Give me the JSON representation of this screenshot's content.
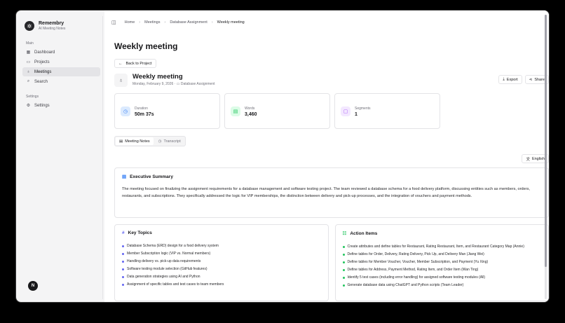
{
  "brand": {
    "title": "Remembry",
    "subtitle": "AI Meeting Notes",
    "logo_icon": "✲"
  },
  "sidebar": {
    "main_label": "Main",
    "items": [
      {
        "label": "Dashboard",
        "icon": "grid-icon",
        "glyph": "▦"
      },
      {
        "label": "Projects",
        "icon": "folder-icon",
        "glyph": "▭"
      },
      {
        "label": "Meetings",
        "icon": "mic-icon",
        "glyph": "♁"
      },
      {
        "label": "Search",
        "icon": "search-icon",
        "glyph": "⌕"
      }
    ],
    "settings_label": "Settings",
    "settings_item": {
      "label": "Settings",
      "icon": "gear-icon",
      "glyph": "⚙"
    },
    "avatar_initial": "N"
  },
  "breadcrumb": {
    "items": [
      "Home",
      "Meetings",
      "Database Assignment"
    ],
    "current": "Weekly meeting"
  },
  "page": {
    "title": "Weekly meeting",
    "back_label": "Back to Project",
    "meeting_title": "Weekly meeting",
    "meeting_date": "Monday, February 9, 2026",
    "meeting_project": "Database Assignment",
    "export_label": "Export",
    "share_label": "Share"
  },
  "stats": [
    {
      "label": "Duration",
      "value": "50m 37s",
      "icon": "clock-icon",
      "glyph": "◷",
      "color": "#3b82f6",
      "bg": "#dbeafe"
    },
    {
      "label": "Words",
      "value": "3,460",
      "icon": "file-text-icon",
      "glyph": "▤",
      "color": "#22c55e",
      "bg": "#dcfce7"
    },
    {
      "label": "Segments",
      "value": "1",
      "icon": "message-icon",
      "glyph": "▢",
      "color": "#a855f7",
      "bg": "#f3e8ff"
    }
  ],
  "tabs": {
    "notes": "Meeting Notes",
    "transcript": "Transcript"
  },
  "language": "English",
  "summary": {
    "title": "Executive Summary",
    "text": "The meeting focused on finalizing the assignment requirements for a database management and software testing project. The team reviewed a database schema for a food delivery platform, discussing entities such as members, orders, restaurants, and subscriptions. They specifically addressed the logic for VIP memberships, the distinction between delivery and pick-up processes, and the integration of vouchers and payment methods."
  },
  "key_topics": {
    "title": "Key Topics",
    "items": [
      "Database Schema (ERD) design for a food delivery system",
      "Member Subscription logic (VIP vs. Normal members)",
      "Handling delivery vs. pick-up data requirements",
      "Software testing module selection (GitHub features)",
      "Data generation strategies using AI and Python",
      "Assignment of specific tables and test cases to team members"
    ]
  },
  "action_items": {
    "title": "Action Items",
    "items": [
      "Create attributes and define tables for Restaurant, Rating Restaurant, Item, and Restaurant Category Map (Annie)",
      "Define tables for Order, Delivery, Rating Delivery, Pick Up, and Delivery Man (Jiang Wei)",
      "Define tables for Member Voucher, Voucher, Member Subscription, and Payment (Yu Xing)",
      "Define tables for Address, Payment Method, Rating Item, and Order Item (Wan Ting)",
      "Identify 5 test cases (including error handling) for assigned software testing modules (All)",
      "Generate database data using ChatGPT and Python scripts (Team Leader)"
    ]
  }
}
